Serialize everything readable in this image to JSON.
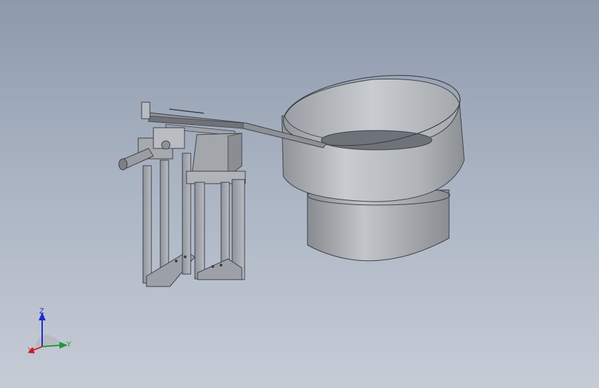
{
  "viewport": {
    "background_top": "#8d9aac",
    "background_bottom": "#c6ccd6"
  },
  "model": {
    "parts": [
      "vibratory-bowl",
      "linear-feeder-track",
      "feeder-stand",
      "actuator-cylinder"
    ],
    "part_color": "#a8acb2"
  },
  "triad": {
    "z_label": "Z",
    "y_label": "Y",
    "x_label": "X",
    "z_color": "#1a2bcc",
    "y_color": "#1f9a3a",
    "x_color": "#cc1f1f"
  }
}
